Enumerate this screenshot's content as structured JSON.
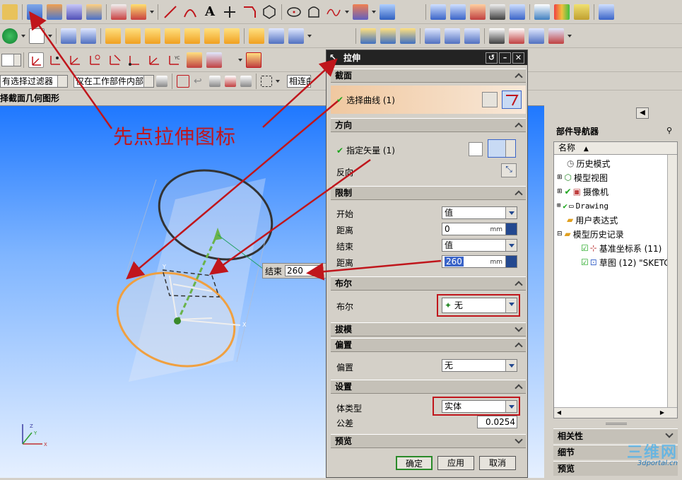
{
  "toolbar3": {
    "filter_label": "有选择过滤器",
    "scope_label": "仅在工作部件内部",
    "snap_label": "相连曲"
  },
  "prompt": {
    "text": "择截面几何图形"
  },
  "annotation": {
    "text": "先点拉伸图标"
  },
  "dialog": {
    "title": "拉伸",
    "section": {
      "header": "截面",
      "select_curve": "选择曲线 (1)"
    },
    "direction": {
      "header": "方向",
      "vector_label": "指定矢量 (1)",
      "reverse_label": "反向"
    },
    "limits": {
      "header": "限制",
      "start_label": "开始",
      "start_value": "值",
      "distance1_label": "距离",
      "distance1_value": "0",
      "distance1_unit": "mm",
      "end_label": "结束",
      "end_value": "值",
      "distance2_label": "距离",
      "distance2_value": "260",
      "distance2_unit": "mm"
    },
    "boolean": {
      "header": "布尔",
      "label": "布尔",
      "value": "无"
    },
    "draft": {
      "header": "拔模"
    },
    "offset": {
      "header": "偏置",
      "label": "偏置",
      "value": "无"
    },
    "settings": {
      "header": "设置",
      "body_type_label": "体类型",
      "body_type_value": "实体",
      "tolerance_label": "公差",
      "tolerance_value": "0.0254"
    },
    "preview": {
      "header": "预览"
    },
    "buttons": {
      "ok": "确定",
      "apply": "应用",
      "cancel": "取消"
    }
  },
  "end_callout": {
    "label": "结束",
    "value": "260"
  },
  "navigator": {
    "title": "部件导航器",
    "column_name": "名称",
    "items": [
      {
        "label": "历史模式"
      },
      {
        "label": "模型视图"
      },
      {
        "label": "摄像机"
      },
      {
        "label": "Drawing"
      },
      {
        "label": "用户表达式"
      },
      {
        "label": "模型历史记录"
      },
      {
        "label": "基准坐标系 (11)"
      },
      {
        "label": "草图 (12) \"SKETCH"
      }
    ],
    "tabs": {
      "relations": "相关性",
      "details": "细节",
      "preview": "预览"
    }
  },
  "watermark": {
    "line1": "三维网",
    "line2": "3dportal.cn"
  },
  "colors": {
    "annotation_red": "#c0161c",
    "dialog_title_bg": "#232323",
    "selected_section": "#f0c8a0"
  }
}
